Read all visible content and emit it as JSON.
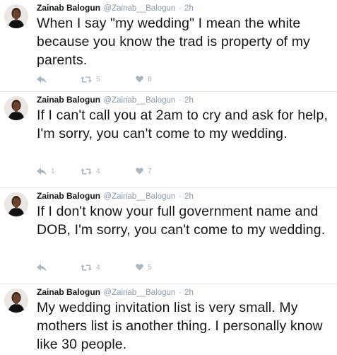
{
  "tweets": [
    {
      "name": "Zainab Balogun",
      "handle": "@Zainab__Balogun",
      "time": "2h",
      "text": "When I say \"my wedding\" I mean the white because you know the trad is property of my parents.",
      "replies": "",
      "retweets": "5",
      "likes": "8"
    },
    {
      "name": "Zainab Balogun",
      "handle": "@Zainab__Balogun",
      "time": "2h",
      "text": "If I can't call you at 2am to cry and ask for help, I'm sorry, you can't come to my wedding.",
      "replies": "1",
      "retweets": "4",
      "likes": "7"
    },
    {
      "name": "Zainab Balogun",
      "handle": "@Zainab__Balogun",
      "time": "2h",
      "text": "If I don't know your full government name and DOB, I'm sorry, you can't come to my wedding.",
      "replies": "",
      "retweets": "4",
      "likes": "5"
    },
    {
      "name": "Zainab Balogun",
      "handle": "@Zainab__Balogun",
      "time": "2h",
      "text": "My wedding invitation list is very small. My mothers list is another thing. I personally know like 30 people.",
      "replies": "",
      "retweets": "",
      "likes": ""
    }
  ],
  "separator": "·",
  "icons": {
    "reply": "reply-icon",
    "retweet": "retweet-icon",
    "like": "heart-icon"
  },
  "colors": {
    "text": "#14171a",
    "muted": "#8899a6",
    "icon": "#aab8c2",
    "border": "#e1e8ed"
  }
}
